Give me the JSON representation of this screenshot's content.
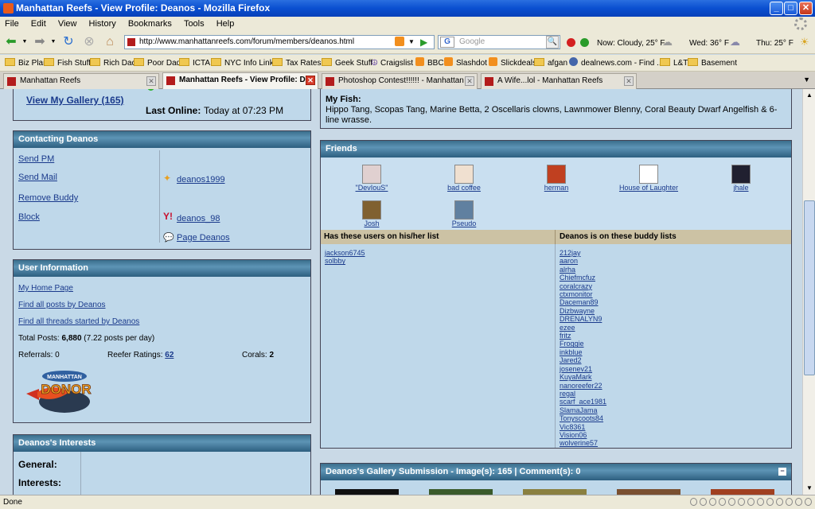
{
  "window": {
    "title": "Manhattan Reefs - View Profile: Deanos - Mozilla Firefox"
  },
  "menu": [
    "File",
    "Edit",
    "View",
    "History",
    "Bookmarks",
    "Tools",
    "Help"
  ],
  "nav": {
    "url": "http://www.manhattanreefs.com/forum/members/deanos.html",
    "search_placeholder": "Google",
    "search_engine": "G"
  },
  "weather": {
    "now": "Now: Cloudy, 25° F",
    "wed": "Wed: 36° F",
    "thu": "Thu: 25° F"
  },
  "bookmarks": [
    {
      "label": "Biz Plan",
      "type": "folder"
    },
    {
      "label": "Fish Stuff",
      "type": "folder"
    },
    {
      "label": "Rich Dad",
      "type": "folder"
    },
    {
      "label": "Poor Dad",
      "type": "folder"
    },
    {
      "label": "ICTA",
      "type": "folder"
    },
    {
      "label": "NYC Info Links",
      "type": "folder"
    },
    {
      "label": "Tax Rates",
      "type": "folder"
    },
    {
      "label": "Geek Stuff",
      "type": "folder"
    },
    {
      "label": "Craigslist",
      "type": "peace"
    },
    {
      "label": "BBC",
      "type": "rss"
    },
    {
      "label": "Slashdot",
      "type": "rss"
    },
    {
      "label": "Slickdeals",
      "type": "rss"
    },
    {
      "label": "afgan",
      "type": "folder"
    },
    {
      "label": "dealnews.com - Find ...",
      "type": "site"
    },
    {
      "label": "L&T",
      "type": "folder"
    },
    {
      "label": "Basement",
      "type": "folder"
    }
  ],
  "tabs": [
    {
      "label": "Manhattan Reefs",
      "active": false
    },
    {
      "label": "Manhattan Reefs - View Profile: D...",
      "active": true
    },
    {
      "label": "Photoshop Contest!!!!!! - Manhattan ...",
      "active": false
    },
    {
      "label": "A Wife...lol - Manhattan Reefs",
      "active": false
    }
  ],
  "profile": {
    "gallery_link": "View My Gallery (165)",
    "last_online_label": "Last Online:",
    "last_online_value": "Today at 07:23 PM",
    "contact": {
      "title": "Contacting Deanos",
      "send_pm": "Send PM",
      "send_mail": "Send Mail",
      "remove_buddy": "Remove Buddy",
      "block": "Block",
      "aim": "deanos1999",
      "yahoo": "deanos_98",
      "page": "Page Deanos"
    },
    "user_info": {
      "title": "User Information",
      "home_page": "My Home Page",
      "all_posts": "Find all posts by Deanos",
      "all_threads": "Find all threads started by Deanos",
      "total_posts_label": "Total Posts:",
      "total_posts": "6,880",
      "posts_per_day": "(7.22 posts per day)",
      "referrals_label": "Referrals:",
      "referrals": "0",
      "reefer_label": "Reefer Ratings:",
      "reefer": "62",
      "corals_label": "Corals:",
      "corals": "2",
      "donor_top": "MANHATTAN",
      "donor_main": "DONOR"
    },
    "interests": {
      "title": "Deanos's Interests",
      "general": "General:",
      "interests": "Interests:"
    },
    "fish": {
      "label": "My Fish:",
      "text": "Hippo Tang, Scopas Tang, Marine Betta, 2 Oscellaris clowns, Lawnmower Blenny, Coral Beauty Dwarf Angelfish & 6-line wrasse."
    },
    "friends": {
      "title": "Friends",
      "list": [
        "\"DevIouS\"",
        "bad coffee",
        "herman",
        "House of Laughter",
        "jhale",
        "Josh",
        "Pseudo"
      ],
      "has_title": "Has these users on his/her list",
      "has_list": [
        "jackson6745",
        "solbby"
      ],
      "on_title": "Deanos is on these buddy lists",
      "on_list": [
        "212jay",
        "aaron",
        "alrha",
        "Chiefmcfuz",
        "coralcrazy",
        "ctxmonitor",
        "Daceman89",
        "Dizbwayne",
        "DRENALYN9",
        "ezee",
        "fritz",
        "Froggie",
        "inkblue",
        "Jared2",
        "josenev21",
        "KuyaMark",
        "nanoreefer22",
        "regal",
        "scarf_ace1981",
        "SlamaJama",
        "Tonyscoots84",
        "Vic8361",
        "Vision06",
        "wolverine57"
      ]
    },
    "gallery": {
      "title": "Deanos's Gallery Submission - Image(s): 165 | Comment(s): 0"
    }
  },
  "status": {
    "text": "Done"
  }
}
